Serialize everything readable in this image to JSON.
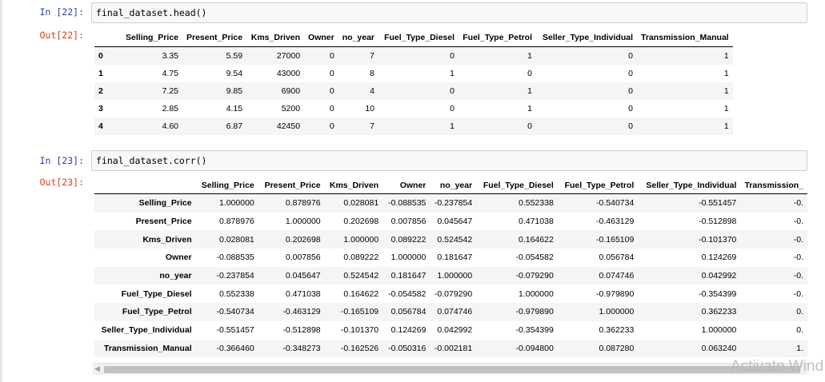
{
  "cells": {
    "in22": {
      "prompt": "In [22]:",
      "code": "final_dataset.head()"
    },
    "out22": {
      "prompt": "Out[22]:"
    },
    "in23": {
      "prompt": "In [23]:",
      "code": "final_dataset.corr()"
    },
    "out23": {
      "prompt": "Out[23]:"
    }
  },
  "head_table": {
    "columns": [
      "",
      "Selling_Price",
      "Present_Price",
      "Kms_Driven",
      "Owner",
      "no_year",
      "Fuel_Type_Diesel",
      "Fuel_Type_Petrol",
      "Seller_Type_Individual",
      "Transmission_Manual"
    ],
    "rows": [
      [
        "0",
        "3.35",
        "5.59",
        "27000",
        "0",
        "7",
        "0",
        "1",
        "0",
        "1"
      ],
      [
        "1",
        "4.75",
        "9.54",
        "43000",
        "0",
        "8",
        "1",
        "0",
        "0",
        "1"
      ],
      [
        "2",
        "7.25",
        "9.85",
        "6900",
        "0",
        "4",
        "0",
        "1",
        "0",
        "1"
      ],
      [
        "3",
        "2.85",
        "4.15",
        "5200",
        "0",
        "10",
        "0",
        "1",
        "0",
        "1"
      ],
      [
        "4",
        "4.60",
        "6.87",
        "42450",
        "0",
        "7",
        "1",
        "0",
        "0",
        "1"
      ]
    ]
  },
  "corr_table": {
    "columns": [
      "",
      "Selling_Price",
      "Present_Price",
      "Kms_Driven",
      "Owner",
      "no_year",
      "Fuel_Type_Diesel",
      "Fuel_Type_Petrol",
      "Seller_Type_Individual",
      "Transmission_"
    ],
    "rows": [
      [
        "Selling_Price",
        "1.000000",
        "0.878976",
        "0.028081",
        "-0.088535",
        "-0.237854",
        "0.552338",
        "-0.540734",
        "-0.551457",
        "-0."
      ],
      [
        "Present_Price",
        "0.878976",
        "1.000000",
        "0.202698",
        "0.007856",
        "0.045647",
        "0.471038",
        "-0.463129",
        "-0.512898",
        "-0."
      ],
      [
        "Kms_Driven",
        "0.028081",
        "0.202698",
        "1.000000",
        "0.089222",
        "0.524542",
        "0.164622",
        "-0.165109",
        "-0.101370",
        "-0."
      ],
      [
        "Owner",
        "-0.088535",
        "0.007856",
        "0.089222",
        "1.000000",
        "0.181647",
        "-0.054582",
        "0.056784",
        "0.124269",
        "-0."
      ],
      [
        "no_year",
        "-0.237854",
        "0.045647",
        "0.524542",
        "0.181647",
        "1.000000",
        "-0.079290",
        "0.074746",
        "0.042992",
        "-0."
      ],
      [
        "Fuel_Type_Diesel",
        "0.552338",
        "0.471038",
        "0.164622",
        "-0.054582",
        "-0.079290",
        "1.000000",
        "-0.979890",
        "-0.354399",
        "-0."
      ],
      [
        "Fuel_Type_Petrol",
        "-0.540734",
        "-0.463129",
        "-0.165109",
        "0.056784",
        "0.074746",
        "-0.979890",
        "1.000000",
        "0.362233",
        "0."
      ],
      [
        "Seller_Type_Individual",
        "-0.551457",
        "-0.512898",
        "-0.101370",
        "0.124269",
        "0.042992",
        "-0.354399",
        "0.362233",
        "1.000000",
        "0."
      ],
      [
        "Transmission_Manual",
        "-0.366460",
        "-0.348273",
        "-0.162526",
        "-0.050316",
        "-0.002181",
        "-0.094800",
        "0.087280",
        "0.063240",
        "1."
      ]
    ]
  },
  "watermark": "Activate Wind",
  "colors": {
    "in_prompt": "#303f9f",
    "out_prompt": "#d84315",
    "row_stripe": "#f5f5f5"
  },
  "icons": {
    "scroll_left": "scroll-left-arrow-icon"
  }
}
